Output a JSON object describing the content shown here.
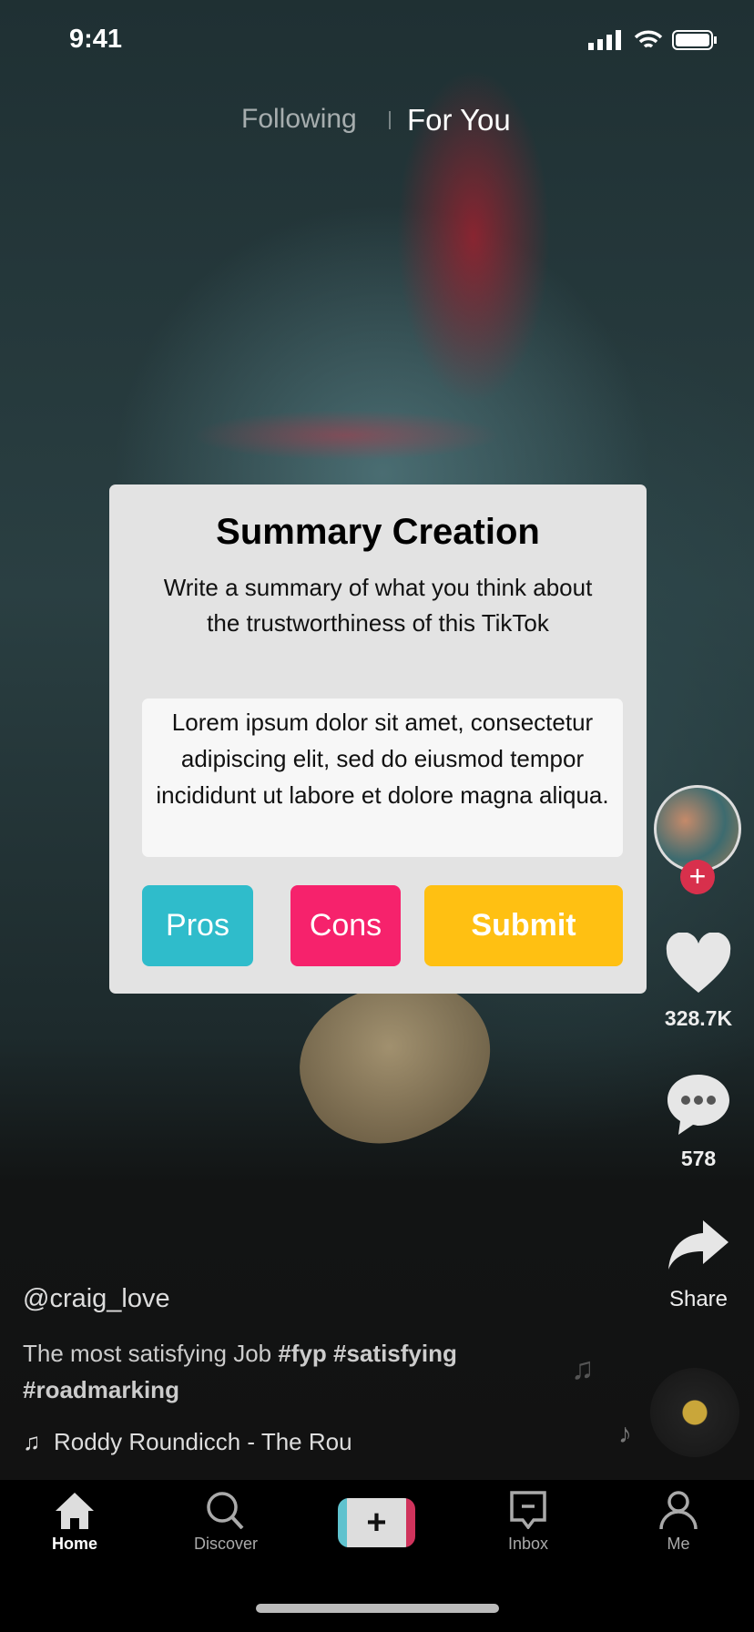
{
  "status_bar": {
    "time": "9:41"
  },
  "top_tabs": [
    {
      "label": "Following",
      "active": false
    },
    {
      "label": "For You",
      "active": true
    }
  ],
  "modal": {
    "title": "Summary Creation",
    "description": "Write a summary of what you think about the trustworthiness of this TikTok",
    "summary_text": "Lorem ipsum dolor sit amet, consectetur adipiscing elit, sed do eiusmod tempor incididunt ut labore et dolore magna aliqua.",
    "buttons": {
      "pros": "Pros",
      "cons": "Cons",
      "submit": "Submit"
    },
    "colors": {
      "pros": "#2fbccb",
      "cons": "#f6226c",
      "submit": "#ffc012"
    }
  },
  "actions": {
    "likes": "328.7K",
    "comments": "578",
    "share": "Share"
  },
  "video": {
    "username": "@craig_love",
    "caption_text": "The most satisfying Job ",
    "hashtags_line1": "#fyp #satisfying",
    "hashtags_line2": "#roadmarking",
    "music": "Roddy Roundicch - The Rou"
  },
  "nav": {
    "home": "Home",
    "discover": "Discover",
    "inbox": "Inbox",
    "me": "Me"
  }
}
